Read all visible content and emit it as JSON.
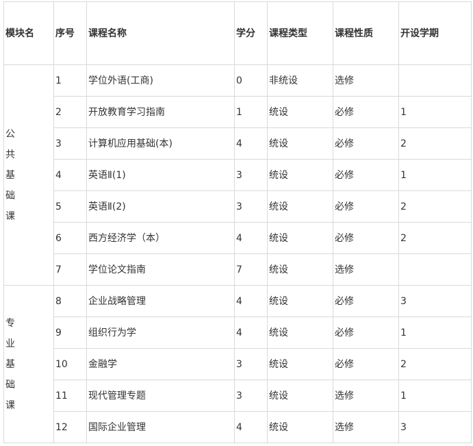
{
  "headers": {
    "module": "模块名",
    "seq": "序号",
    "name": "课程名称",
    "credit": "学分",
    "type": "课程类型",
    "nature": "课程性质",
    "term": "开设学期"
  },
  "modules": [
    {
      "name_chars": [
        "公",
        "共",
        "基",
        "础",
        "课"
      ],
      "rows": [
        {
          "seq": "1",
          "name": "学位外语(工商)",
          "credit": "0",
          "type": "非统设",
          "nature": "选修",
          "term": ""
        },
        {
          "seq": "2",
          "name": "开放教育学习指南",
          "credit": "1",
          "type": "统设",
          "nature": "必修",
          "term": "1"
        },
        {
          "seq": "3",
          "name": "计算机应用基础(本)",
          "credit": "4",
          "type": "统设",
          "nature": "必修",
          "term": "2"
        },
        {
          "seq": "4",
          "name": "英语Ⅱ(1)",
          "credit": "3",
          "type": "统设",
          "nature": "必修",
          "term": "1"
        },
        {
          "seq": "5",
          "name": "英语Ⅱ(2)",
          "credit": "3",
          "type": "统设",
          "nature": "必修",
          "term": "2"
        },
        {
          "seq": "6",
          "name": "西方经济学（本）",
          "credit": "4",
          "type": "统设",
          "nature": "必修",
          "term": "2"
        },
        {
          "seq": "7",
          "name": "学位论文指南",
          "credit": "7",
          "type": "统设",
          "nature": "选修",
          "term": ""
        }
      ]
    },
    {
      "name_chars": [
        "专",
        "业",
        "基",
        "础",
        "课"
      ],
      "rows": [
        {
          "seq": "8",
          "name": "企业战略管理",
          "credit": "4",
          "type": "统设",
          "nature": "必修",
          "term": "3"
        },
        {
          "seq": "9",
          "name": "组织行为学",
          "credit": "4",
          "type": "统设",
          "nature": "必修",
          "term": "1"
        },
        {
          "seq": "10",
          "name": "金融学",
          "credit": "3",
          "type": "统设",
          "nature": "必修",
          "term": "2"
        },
        {
          "seq": "11",
          "name": "现代管理专题",
          "credit": "3",
          "type": "统设",
          "nature": "选修",
          "term": "1"
        },
        {
          "seq": "12",
          "name": "国际企业管理",
          "credit": "4",
          "type": "统设",
          "nature": "选修",
          "term": "3"
        }
      ]
    }
  ]
}
